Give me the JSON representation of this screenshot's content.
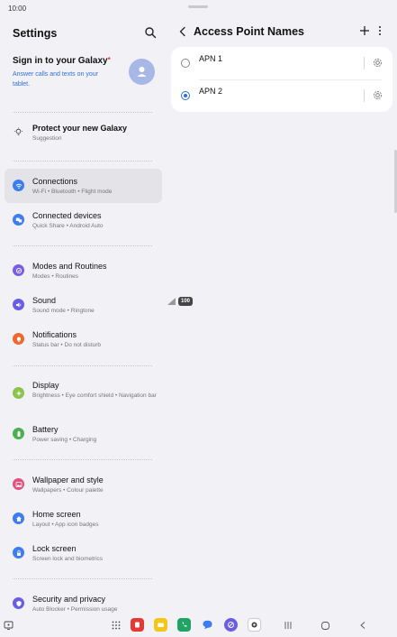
{
  "status": {
    "time": "10:00",
    "battery": "100"
  },
  "settings": {
    "title": "Settings",
    "signin": {
      "title": "Sign in to your Galaxy",
      "subtitle": "Answer calls and texts on your tablet."
    },
    "items": [
      {
        "label": "Protect your new Galaxy",
        "sub": "Suggestion"
      },
      {
        "label": "Connections",
        "sub": "Wi-Fi • Bluetooth • Flight mode"
      },
      {
        "label": "Connected devices",
        "sub": "Quick Share • Android Auto"
      },
      {
        "label": "Modes and Routines",
        "sub": "Modes • Routines"
      },
      {
        "label": "Sound",
        "sub": "Sound mode • Ringtone"
      },
      {
        "label": "Notifications",
        "sub": "Status bar • Do not disturb"
      },
      {
        "label": "Display",
        "sub": "Brightness • Eye comfort shield • Navigation bar"
      },
      {
        "label": "Battery",
        "sub": "Power saving • Charging"
      },
      {
        "label": "Wallpaper and style",
        "sub": "Wallpapers • Colour palette"
      },
      {
        "label": "Home screen",
        "sub": "Layout • App icon badges"
      },
      {
        "label": "Lock screen",
        "sub": "Screen lock and biometrics"
      },
      {
        "label": "Security and privacy",
        "sub": "Auto Blocker • Permission usage"
      }
    ]
  },
  "apn": {
    "title": "Access Point Names",
    "entries": [
      {
        "name": "APN 1",
        "selected": false
      },
      {
        "name": "APN 2",
        "selected": true
      }
    ]
  },
  "colors": {
    "accent": "#2f6fd8",
    "connections": "#3d7df0",
    "devices": "#3d7df0",
    "modes": "#7a5ce6",
    "sound": "#6b5ce6",
    "notifications": "#ee6a2c",
    "display": "#8bc34a",
    "battery": "#4caf50",
    "wallpaper": "#e0527f",
    "home": "#3d7df0",
    "lock": "#3d7df0",
    "security": "#6b5ce6"
  }
}
